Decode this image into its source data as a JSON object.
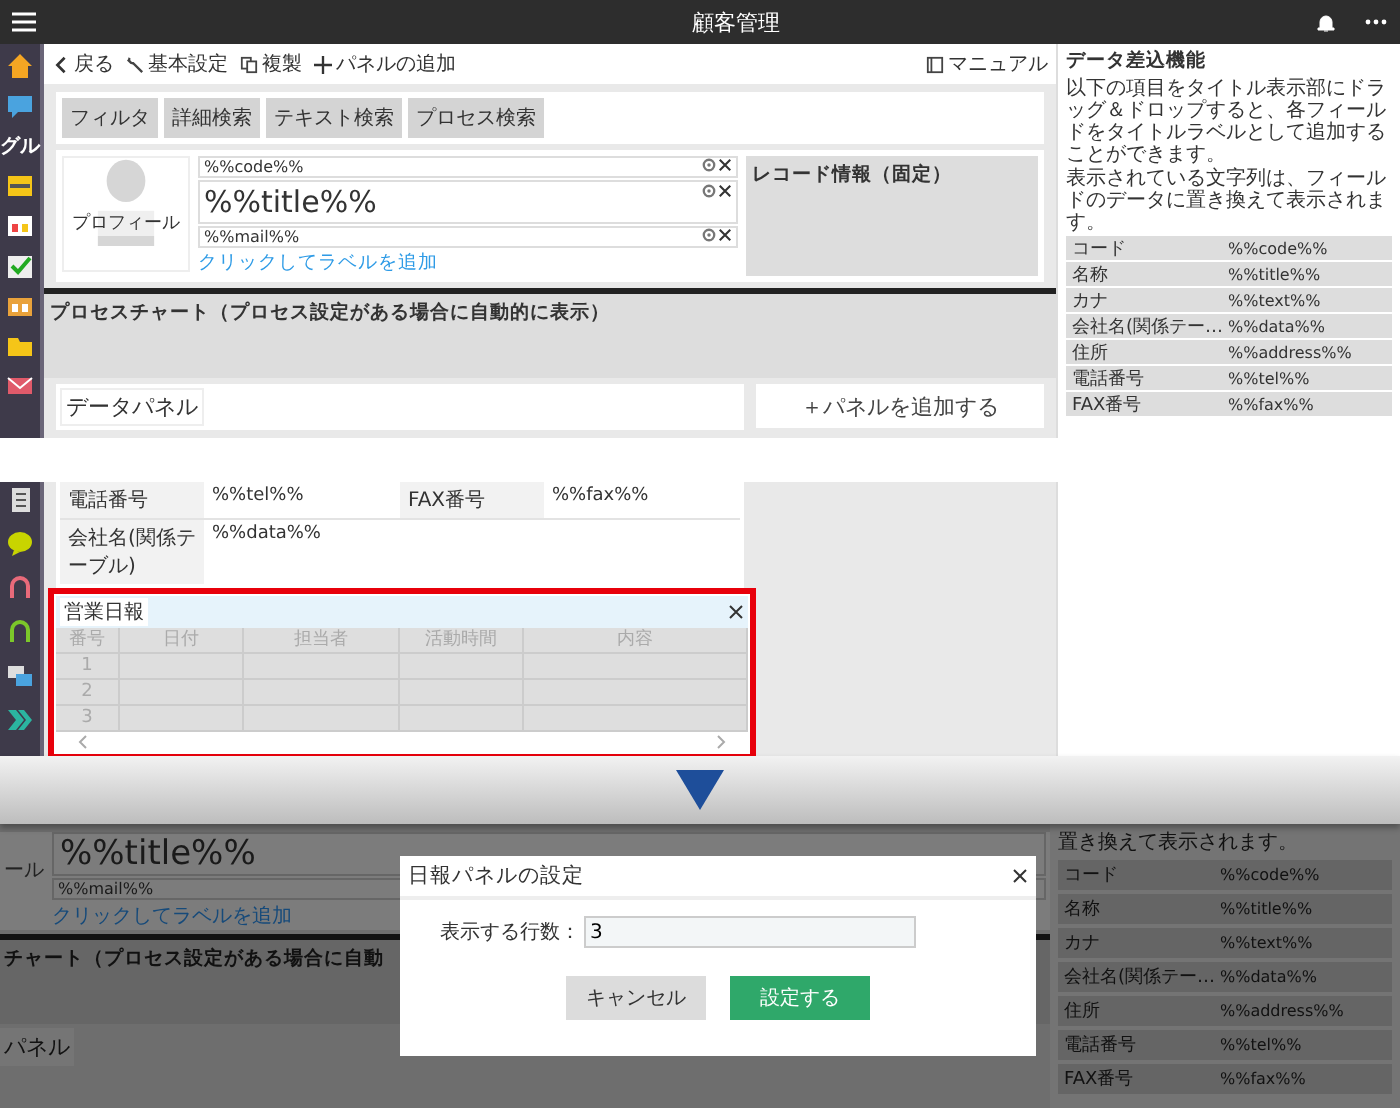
{
  "header": {
    "title": "顧客管理"
  },
  "sidebar": {
    "group_label": "グル"
  },
  "toolbar": {
    "items": [
      {
        "label": "戻る",
        "kind": "back"
      },
      {
        "label": "基本設定",
        "kind": "settings"
      },
      {
        "label": "複製",
        "kind": "copy"
      },
      {
        "label": "パネルの追加",
        "kind": "add"
      }
    ],
    "manual": "マニュアル"
  },
  "search_tabs": [
    "フィルタ",
    "詳細検索",
    "テキスト検索",
    "プロセス検索"
  ],
  "title_area": {
    "profile_label": "プロフィール",
    "fields": [
      {
        "text": "%%code%%",
        "large": false
      },
      {
        "text": "%%title%%",
        "large": true
      },
      {
        "text": "%%mail%%",
        "large": false
      }
    ],
    "add_label_link": "クリックしてラベルを追加",
    "record_info": "レコード情報（固定）"
  },
  "process_chart": "プロセスチャート（プロセス設定がある場合に自動的に表示）",
  "data_panel": {
    "title": "データパネル",
    "rows_after_break": [
      {
        "cells": [
          {
            "label": "電話番号",
            "value": "%%tel%%"
          },
          {
            "label": "FAX番号",
            "value": "%%fax%%"
          }
        ]
      },
      {
        "cells": [
          {
            "label": "会社名(関係テーブル)",
            "value": "%%data%%"
          }
        ]
      }
    ]
  },
  "add_panel": "＋パネルを追加する",
  "report_panel": {
    "title": "営業日報",
    "highlighted": true,
    "columns": [
      "番号",
      "日付",
      "担当者",
      "活動時間",
      "内容"
    ],
    "rows": [
      "1",
      "2",
      "3"
    ]
  },
  "insert_panel": {
    "title": "データ差込機能",
    "description": [
      "以下の項目をタイトル表示部にドラッグ＆ドロップすると、各フィールドをタイトルラベルとして追加することができます。",
      "表示されている文字列は、フィールドのデータに置き換えて表示されます。"
    ],
    "items": [
      {
        "name": "コード",
        "tag": "%%code%%"
      },
      {
        "name": "名称",
        "tag": "%%title%%"
      },
      {
        "name": "カナ",
        "tag": "%%text%%"
      },
      {
        "name": "会社名(関係テー…",
        "tag": "%%data%%"
      },
      {
        "name": "住所",
        "tag": "%%address%%"
      },
      {
        "name": "電話番号",
        "tag": "%%tel%%"
      },
      {
        "name": "FAX番号",
        "tag": "%%fax%%"
      }
    ]
  },
  "after_view": {
    "profile_label": "ール",
    "title_field": "%%title%%",
    "mail_field": "%%mail%%",
    "add_label_link": "クリックしてラベルを追加",
    "process_chart": "チャート（プロセス設定がある場合に自動",
    "data_panel_title": "パネル",
    "description": "置き換えて表示されます。",
    "items": [
      {
        "name": "コード",
        "tag": "%%code%%"
      },
      {
        "name": "名称",
        "tag": "%%title%%"
      },
      {
        "name": "カナ",
        "tag": "%%text%%"
      },
      {
        "name": "会社名(関係テー…",
        "tag": "%%data%%"
      },
      {
        "name": "住所",
        "tag": "%%address%%"
      },
      {
        "name": "電話番号",
        "tag": "%%tel%%"
      },
      {
        "name": "FAX番号",
        "tag": "%%fax%%"
      }
    ]
  },
  "dialog": {
    "title": "日報パネルの設定",
    "field_label": "表示する行数：",
    "field_value": "3",
    "buttons": [
      {
        "label": "キャンセル",
        "kind": "secondary"
      },
      {
        "label": "設定する",
        "kind": "primary"
      }
    ]
  }
}
